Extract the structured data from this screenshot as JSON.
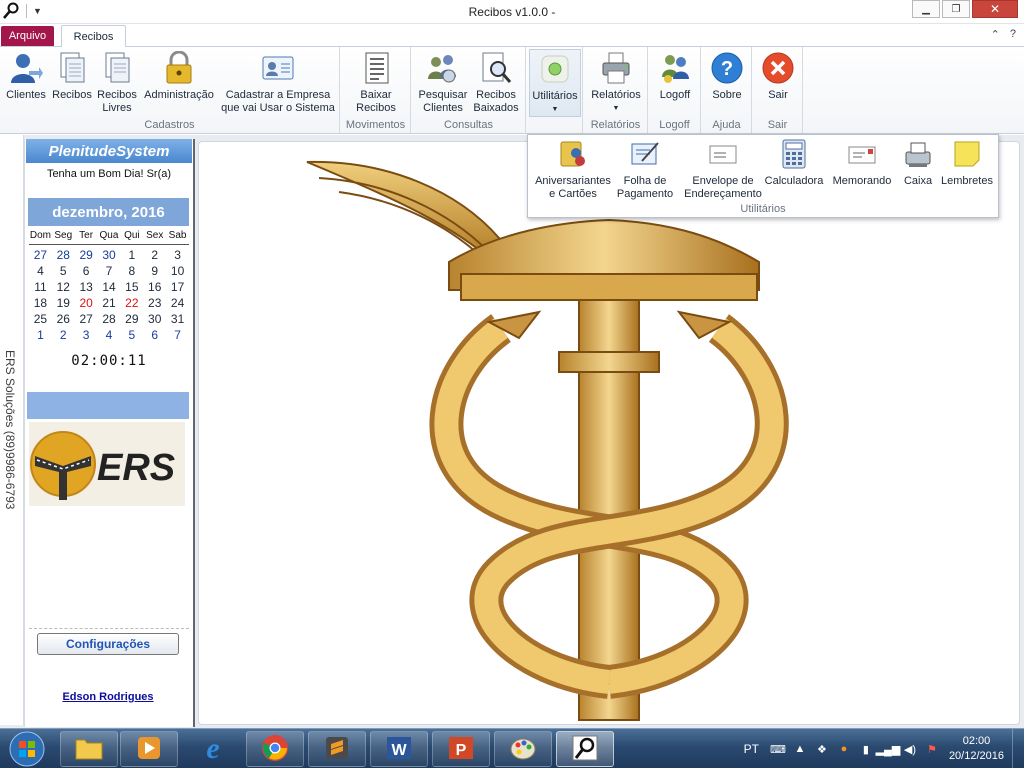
{
  "window": {
    "title": "Recibos v1.0.0 -"
  },
  "tabs": {
    "file": "Arquivo",
    "active": "Recibos"
  },
  "ribbon": {
    "cadastros": {
      "label": "Cadastros",
      "clientes": "Clientes",
      "recibos": "Recibos",
      "recibos_livres_1": "Recibos",
      "recibos_livres_2": "Livres",
      "administracao": "Administração",
      "empresa_1": "Cadastrar a Empresa",
      "empresa_2": "que vai Usar o Sistema"
    },
    "movimentos": {
      "label": "Movimentos",
      "baixar_1": "Baixar",
      "baixar_2": "Recibos"
    },
    "consultas": {
      "label": "Consultas",
      "pesq_1": "Pesquisar",
      "pesq_2": "Clientes",
      "baix_1": "Recibos",
      "baix_2": "Baixados"
    },
    "utilitarios": {
      "button": "Utilitários"
    },
    "relatorios": {
      "label": "Relatórios",
      "button": "Relatórios"
    },
    "logoff": {
      "label": "Logoff",
      "button": "Logoff"
    },
    "ajuda": {
      "label": "Ajuda",
      "button": "Sobre"
    },
    "sair": {
      "label": "Sair",
      "button": "Sair"
    }
  },
  "dropdown": {
    "label": "Utilitários",
    "aniv_1": "Aniversariantes",
    "aniv_2": "e Cartões",
    "folha_1": "Folha de",
    "folha_2": "Pagamento",
    "env_1": "Envelope de",
    "env_2": "Endereçamento",
    "calc": "Calculadora",
    "memo": "Memorando",
    "caixa": "Caixa",
    "lemb": "Lembretes"
  },
  "sidebar": {
    "vertical_text": "ERS Soluções (89)9986-6793",
    "brand": "PlenitudeSystem",
    "greeting": "Tenha um Bom Dia! Sr(a)",
    "month": "dezembro, 2016",
    "dow": [
      "Dom",
      "Seg",
      "Ter",
      "Qua",
      "Qui",
      "Sex",
      "Sab"
    ],
    "weeks": [
      [
        "27",
        "28",
        "29",
        "30",
        "1",
        "2",
        "3"
      ],
      [
        "4",
        "5",
        "6",
        "7",
        "8",
        "9",
        "10"
      ],
      [
        "11",
        "12",
        "13",
        "14",
        "15",
        "16",
        "17"
      ],
      [
        "18",
        "19",
        "20",
        "21",
        "22",
        "23",
        "24"
      ],
      [
        "25",
        "26",
        "27",
        "28",
        "29",
        "30",
        "31"
      ],
      [
        "1",
        "2",
        "3",
        "4",
        "5",
        "6",
        "7"
      ]
    ],
    "clock": "02:00:11",
    "config": "Configurações",
    "author": "Edson Rodrigues",
    "logo_text": "ERS"
  },
  "taskbar": {
    "lang": "PT",
    "time": "02:00",
    "date": "20/12/2016"
  },
  "colors": {
    "file_tab": "#a2164c",
    "accent": "#4a87cf",
    "taskbar": "#2b4a70"
  }
}
